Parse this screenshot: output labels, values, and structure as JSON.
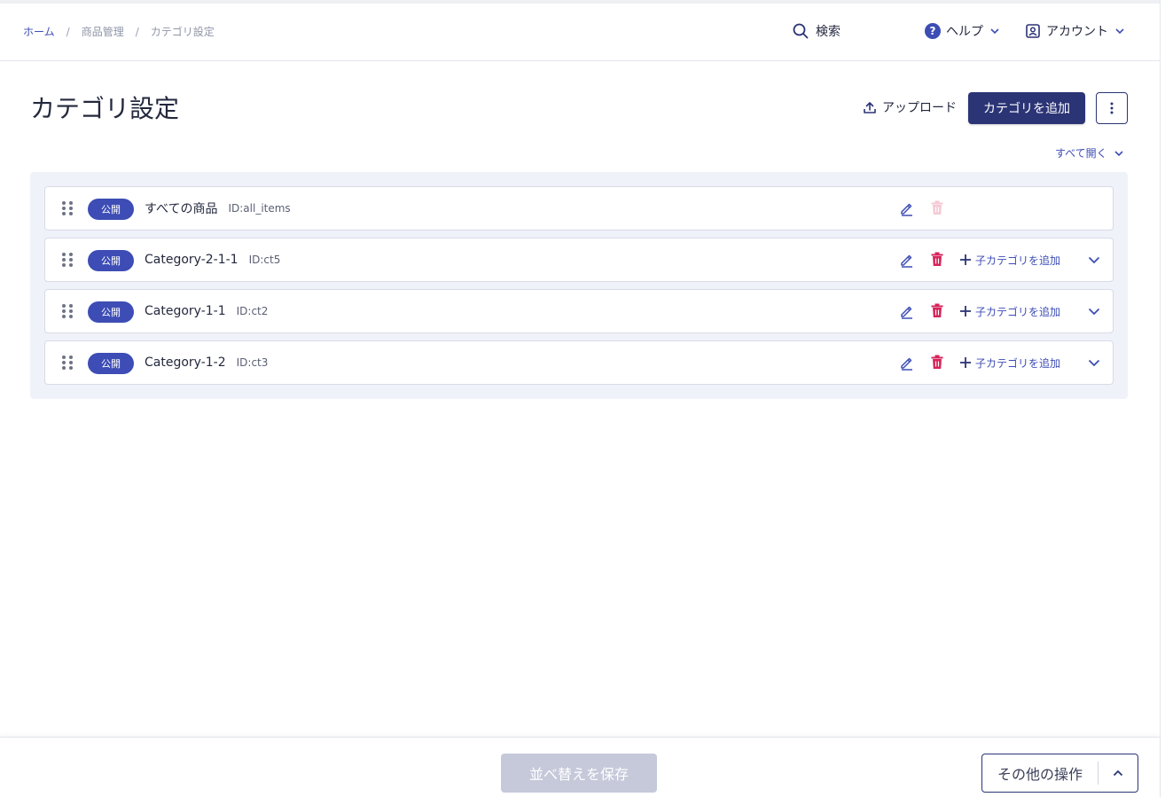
{
  "breadcrumb": {
    "home": "ホーム",
    "products": "商品管理",
    "current": "カテゴリ設定",
    "separator": "/"
  },
  "header": {
    "search_label": "検索",
    "help_label": "ヘルプ",
    "account_label": "アカウント"
  },
  "page": {
    "title": "カテゴリ設定",
    "upload_label": "アップロード",
    "add_category_label": "カテゴリを追加",
    "expand_all_label": "すべて開く"
  },
  "categories": [
    {
      "status": "公開",
      "name": "すべての商品",
      "id": "ID:all_items",
      "deletable": false,
      "has_children_action": false
    },
    {
      "status": "公開",
      "name": "Category-2-1-1",
      "id": "ID:ct5",
      "deletable": true,
      "has_children_action": true,
      "add_child_label": "子カテゴリを追加"
    },
    {
      "status": "公開",
      "name": "Category-1-1",
      "id": "ID:ct2",
      "deletable": true,
      "has_children_action": true,
      "add_child_label": "子カテゴリを追加"
    },
    {
      "status": "公開",
      "name": "Category-1-2",
      "id": "ID:ct3",
      "deletable": true,
      "has_children_action": true,
      "add_child_label": "子カテゴリを追加"
    }
  ],
  "footer": {
    "save_order_label": "並べ替えを保存",
    "other_actions_label": "その他の操作"
  },
  "colors": {
    "primary": "#2b3475",
    "accent": "#3d4db5",
    "danger": "#d6245a",
    "danger_disabled": "#f5c9d6",
    "panel_bg": "#f0f2fa",
    "disabled_button": "#c5c9da"
  },
  "icons": {
    "search": "search-icon",
    "help": "help-icon",
    "account": "account-icon",
    "upload": "upload-icon",
    "more": "more-vertical-icon",
    "drag": "drag-handle-icon",
    "edit": "edit-icon",
    "delete": "trash-icon",
    "add": "plus-icon",
    "expand": "chevron-down-icon"
  }
}
